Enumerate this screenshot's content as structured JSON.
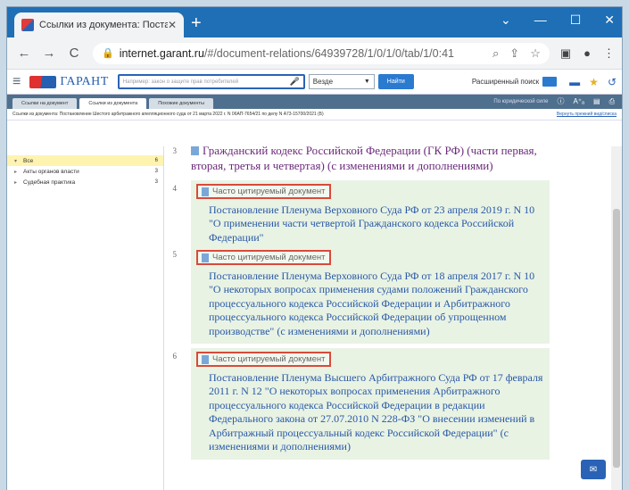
{
  "browser": {
    "tab_title": "Ссылки из документа: Постано",
    "tab_close": "✕",
    "new_tab": "+",
    "window_controls": [
      "⌄",
      "—",
      "☐",
      "✕"
    ],
    "url_host": "internet.garant.ru",
    "url_path": "/#/document-relations/64939728/1/0/1/0/tab/1/0:41"
  },
  "garant": {
    "logo_small": "СИСТЕМА",
    "logo_text": "ГАРАНТ",
    "search_placeholder": "Например: закон о защите прав потребителей",
    "scope_select": "Везде",
    "find_button": "Найти",
    "advanced_search": "Расширенный поиск",
    "tabs": [
      "Ссылки на документ",
      "Ссылки из документа",
      "Похожие документы"
    ],
    "active_tab": 1,
    "jurisdiction_link": "По юридической силе",
    "breadcrumb": "Ссылки из документа: Постановление Шестого арбитражного апелляционного суда от 21 марта 2022 г. N 06АП-7654/21 по делу N А73-15700/2021 (Б)",
    "breadcrumb_right": "Вернуть прежний вид/списка"
  },
  "sidebar": {
    "items": [
      {
        "label": "Все",
        "count": "6",
        "selected": true
      },
      {
        "label": "Акты органов власти",
        "count": "3",
        "selected": false
      },
      {
        "label": "Судебная практика",
        "count": "3",
        "selected": false
      }
    ]
  },
  "documents": [
    {
      "num": "3",
      "badge": "",
      "title": "Гражданский кодекс Российской Федерации (ГК РФ) (части первая, вторая, третья и четвертая) (с изменениями и дополнениями)"
    },
    {
      "num": "4",
      "badge": "Часто цитируемый документ",
      "title": "Постановление Пленума Верховного Суда РФ от 23 апреля 2019 г. N 10 \"О применении части четвертой Гражданского кодекса Российской Федерации\""
    },
    {
      "num": "5",
      "badge": "Часто цитируемый документ",
      "title": "Постановление Пленума Верховного Суда РФ от 18 апреля 2017 г. N 10 \"О некоторых вопросах применения судами положений Гражданского процессуального кодекса Российской Федерации и Арбитражного процессуального кодекса Российской Федерации об упрощенном производстве\" (с изменениями и дополнениями)"
    },
    {
      "num": "6",
      "badge": "Часто цитируемый документ",
      "title": "Постановление Пленума Высшего Арбитражного Суда РФ от 17 февраля 2011 г. N 12 \"О некоторых вопросах применения Арбитражного процессуального кодекса Российской Федерации в редакции Федерального закона от 27.07.2010 N 228-ФЗ \"О внесении изменений в Арбитражный процессуальный кодекс Российской Федерации\" (с изменениями и дополнениями)"
    }
  ],
  "colors": {
    "accent": "#2a63b5",
    "highlight_border": "#d94a3a",
    "card_bg": "#e9f3e4",
    "link_purple": "#6b2a7a"
  }
}
